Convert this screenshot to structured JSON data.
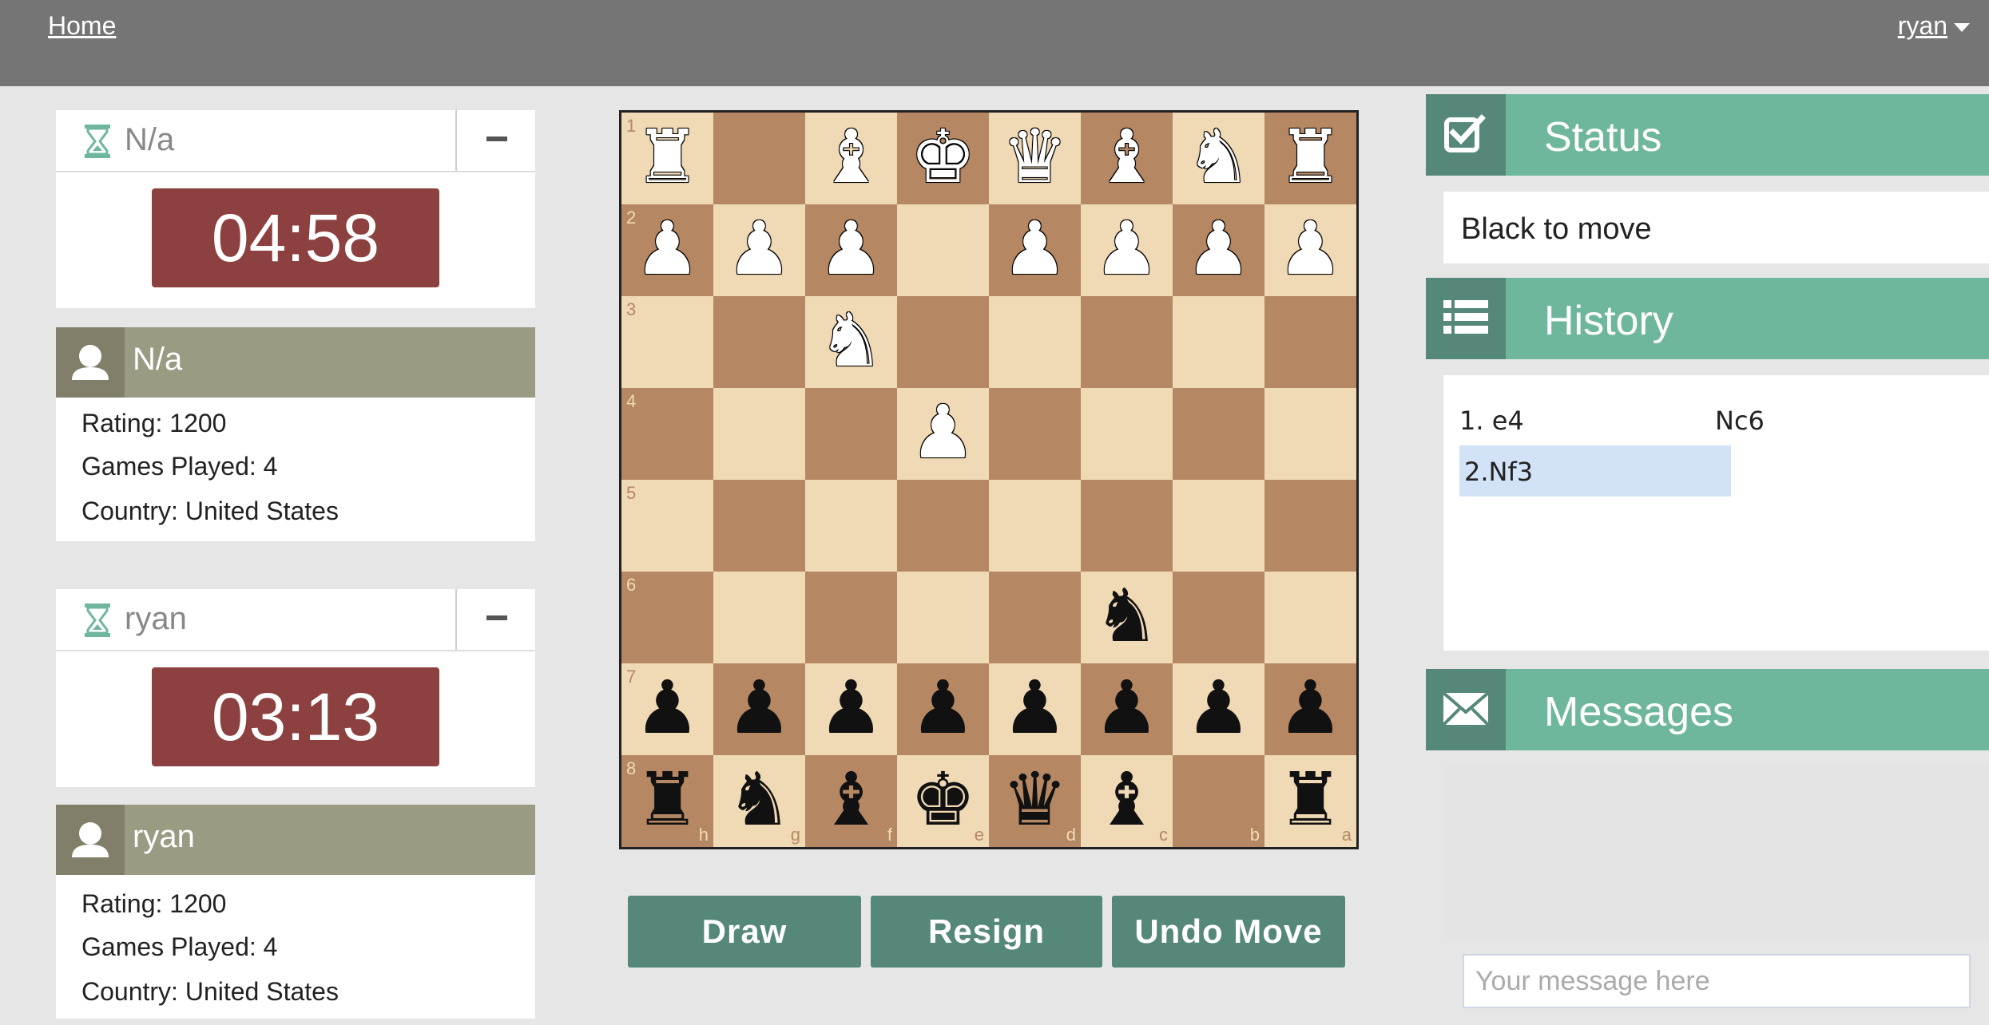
{
  "nav": {
    "home_label": "Home",
    "user_label": "ryan"
  },
  "top_player": {
    "clock_name": "N/a",
    "time": "04:58",
    "profile_name": "N/a",
    "rating": "Rating: 1200",
    "games_played": "Games Played: 4",
    "country": "Country: United States"
  },
  "bottom_player": {
    "clock_name": "ryan",
    "time": "03:13",
    "profile_name": "ryan",
    "rating": "Rating: 1200",
    "games_played": "Games Played: 4",
    "country": "Country: United States"
  },
  "board": {
    "rank_labels": [
      "1",
      "2",
      "3",
      "4",
      "5",
      "6",
      "7",
      "8"
    ],
    "file_labels": [
      "h",
      "g",
      "f",
      "e",
      "d",
      "c",
      "b",
      "a"
    ],
    "rows": [
      [
        "wR",
        "",
        "wB",
        "wK",
        "wQ",
        "wB",
        "wN",
        "wR"
      ],
      [
        "wP",
        "wP",
        "wP",
        "",
        "wP",
        "wP",
        "wP",
        "wP"
      ],
      [
        "",
        "",
        "wN",
        "",
        "",
        "",
        "",
        ""
      ],
      [
        "",
        "",
        "",
        "wP",
        "",
        "",
        "",
        ""
      ],
      [
        "",
        "",
        "",
        "",
        "",
        "",
        "",
        ""
      ],
      [
        "",
        "",
        "",
        "",
        "",
        "bN",
        "",
        ""
      ],
      [
        "bP",
        "bP",
        "bP",
        "bP",
        "bP",
        "bP",
        "bP",
        "bP"
      ],
      [
        "bR",
        "bN",
        "bB",
        "bK",
        "bQ",
        "bB",
        "",
        "bR"
      ]
    ],
    "light_color": "#f0d9b5",
    "dark_color": "#b58863"
  },
  "actions": {
    "draw": "Draw",
    "resign": "Resign",
    "undo": "Undo Move"
  },
  "status": {
    "title": "Status",
    "text": "Black to move"
  },
  "history": {
    "title": "History",
    "moves": [
      {
        "num": "1.",
        "white": "e4",
        "black": "Nc6"
      },
      {
        "num": "2.",
        "white": "Nf3",
        "black": ""
      }
    ]
  },
  "messages": {
    "title": "Messages",
    "placeholder": "Your message here"
  },
  "colors": {
    "accent": "#6fb79c",
    "accent_dark": "#55877a",
    "timer": "#8c4040",
    "profile": "#9b9a82",
    "nav": "#757575"
  }
}
